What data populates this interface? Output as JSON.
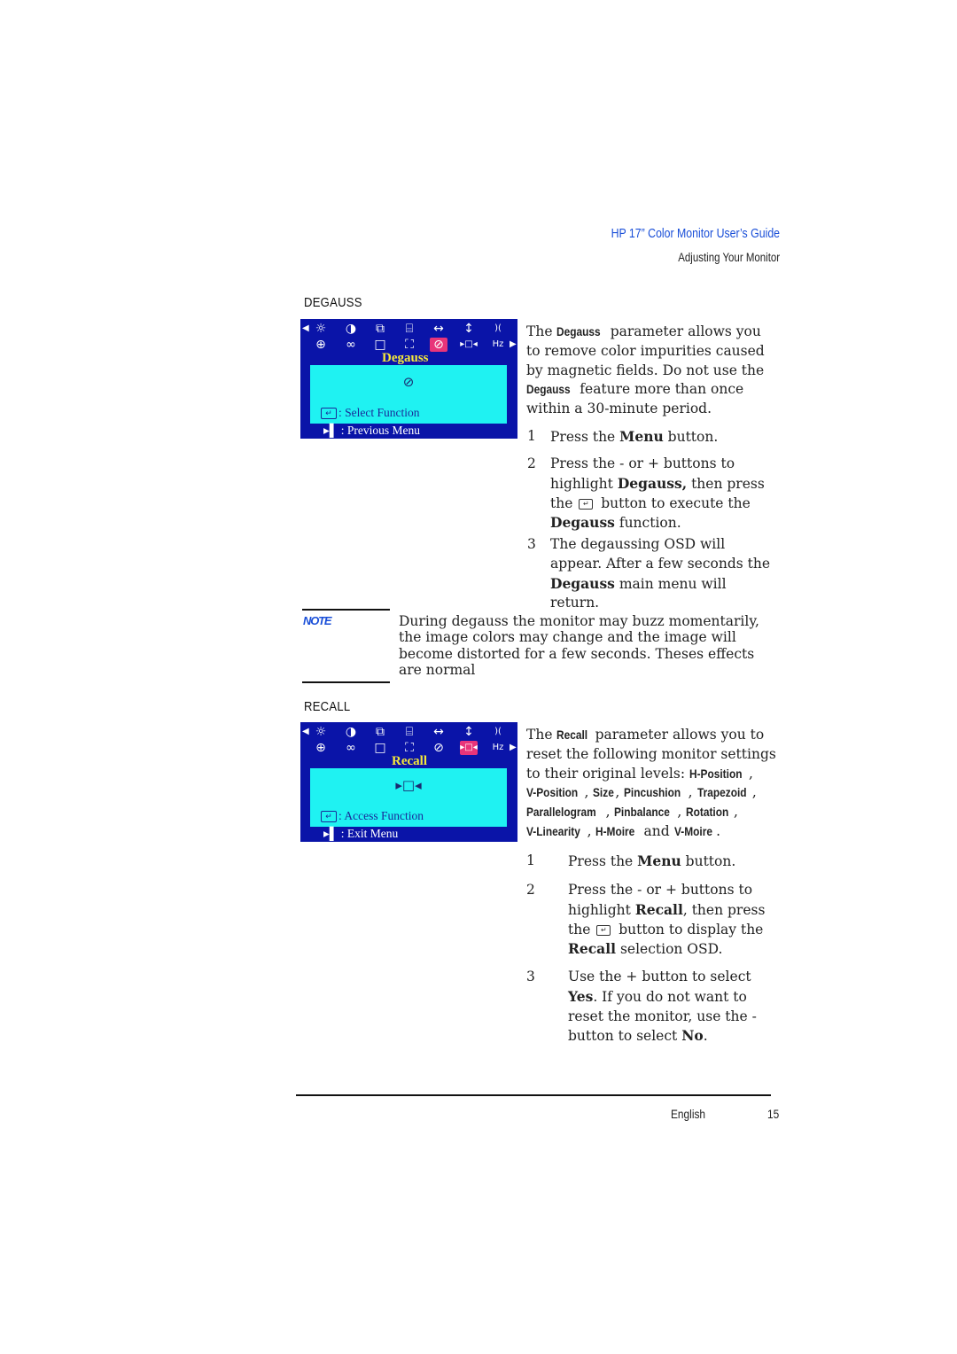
{
  "header": {
    "title": "HP 17” Color Monitor User’s Guide",
    "subtitle": "Adjusting Your Monitor",
    "title_color": "#1a4fd8"
  },
  "degauss": {
    "heading": "DEGAUSS",
    "osd": {
      "title": "Degauss",
      "highlighted_icon": "degauss-icon",
      "panel_line": ": Select Function",
      "footer_line": ": Previous Menu",
      "colors": {
        "background": "#0a14a8",
        "panel": "#1ff2f2",
        "highlight": "#e8347a",
        "title": "#f5e83a"
      }
    },
    "intro": [
      {
        "t": "The "
      },
      {
        "b": "Degauss"
      },
      {
        "t": " parameter allows you to remove color impurities caused by magnetic fields. Do not use the "
      },
      {
        "b": "Degauss"
      },
      {
        "t": " feature more than once within a 30-minute period."
      }
    ],
    "steps": [
      {
        "num": "1",
        "parts": [
          {
            "t": "Press the "
          },
          {
            "b": "Menu"
          },
          {
            "t": " button."
          }
        ]
      },
      {
        "num": "2",
        "parts": [
          {
            "t": "Press the - or + buttons to highlight "
          },
          {
            "b": "Degauss,"
          },
          {
            "t": " then press the "
          },
          {
            "icon": "enter"
          },
          {
            "t": " button to execute the "
          },
          {
            "b": "Degauss"
          },
          {
            "t": " function."
          }
        ]
      },
      {
        "num": "3",
        "parts": [
          {
            "t": "The degaussing OSD will appear. After a few seconds the "
          },
          {
            "b": "Degauss"
          },
          {
            "t": " main menu will return."
          }
        ]
      }
    ]
  },
  "note": {
    "label": "NOTE",
    "text": "During degauss the monitor may buzz momentarily, the image colors may change and the image will become distorted for a few seconds. Theses effects are normal"
  },
  "recall": {
    "heading": "RECALL",
    "osd": {
      "title": "Recall",
      "highlighted_icon": "recall-icon",
      "panel_line": ": Access Function",
      "footer_line": ": Exit Menu"
    },
    "intro": [
      {
        "t": "The "
      },
      {
        "b": "Recall"
      },
      {
        "t": " parameter allows you to reset the following monitor settings to their original levels: "
      },
      {
        "b": "H-Position"
      },
      {
        "t": ", "
      },
      {
        "b": "V-Position"
      },
      {
        "t": ", "
      },
      {
        "b": "Size"
      },
      {
        "t": ", "
      },
      {
        "b": "Pincushion"
      },
      {
        "t": ", "
      },
      {
        "b": "Trapezoid"
      },
      {
        "t": ", "
      },
      {
        "b": "Parallelogram"
      },
      {
        "t": ", "
      },
      {
        "b": "Pinbalance"
      },
      {
        "t": ", "
      },
      {
        "b": "Rotation"
      },
      {
        "t": ", "
      },
      {
        "b": "V-Linearity"
      },
      {
        "t": ", "
      },
      {
        "b": "H-Moire"
      },
      {
        "t": " and "
      },
      {
        "b": "V-Moire"
      },
      {
        "t": "."
      }
    ],
    "steps": [
      {
        "num": "1",
        "parts": [
          {
            "t": "Press the "
          },
          {
            "b": "Menu"
          },
          {
            "t": " button."
          }
        ]
      },
      {
        "num": "2",
        "parts": [
          {
            "t": "Press the - or + buttons to highlight "
          },
          {
            "b": "Recall"
          },
          {
            "t": ", then press the "
          },
          {
            "icon": "enter"
          },
          {
            "t": " button to display the "
          },
          {
            "b": "Recall"
          },
          {
            "t": " selection OSD."
          }
        ]
      },
      {
        "num": "3",
        "parts": [
          {
            "t": "Use the + button to select "
          },
          {
            "b": "Yes"
          },
          {
            "t": ". If you do not want to reset the monitor, use the - button to select "
          },
          {
            "b": "No"
          },
          {
            "t": "."
          }
        ]
      }
    ]
  },
  "osd_icons": [
    {
      "name": "brightness-icon",
      "glyph": "☼"
    },
    {
      "name": "contrast-icon",
      "glyph": "◑"
    },
    {
      "name": "h-position-icon",
      "glyph": "⧉"
    },
    {
      "name": "v-position-icon",
      "glyph": "⌸"
    },
    {
      "name": "h-size-icon",
      "glyph": "↔"
    },
    {
      "name": "v-size-icon",
      "glyph": "↕"
    },
    {
      "name": "pincushion-icon",
      "glyph": ")("
    },
    {
      "name": "rotation-icon",
      "glyph": "⊕"
    },
    {
      "name": "moire-icon",
      "glyph": "∞"
    },
    {
      "name": "trapezoid-icon",
      "glyph": "□"
    },
    {
      "name": "size-icon",
      "glyph": "⛶"
    },
    {
      "name": "degauss-icon",
      "glyph": "⊘"
    },
    {
      "name": "recall-icon",
      "glyph": "▸□◂"
    },
    {
      "name": "frequency-icon",
      "glyph": "Hz"
    }
  ],
  "footer": {
    "language": "English",
    "page_number": "15"
  }
}
